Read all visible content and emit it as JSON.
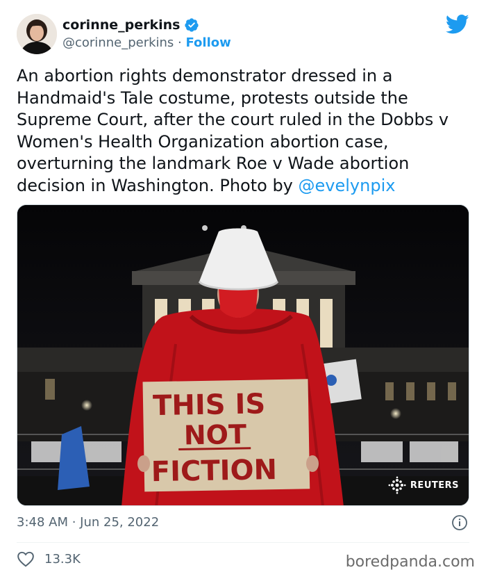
{
  "author": {
    "display_name": "corinne_perkins",
    "handle": "@corinne_perkins",
    "separator": " · ",
    "follow_label": "Follow",
    "verified_icon": "verified-badge-icon",
    "avatar_icon": "avatar"
  },
  "platform_icon": "twitter-bird-icon",
  "tweet": {
    "text": "An abortion rights demonstrator dressed in a Handmaid's Tale costume, protests outside the Supreme Court, after the court ruled in the Dobbs v Women's Health Organization abortion case, overturning the landmark Roe v Wade abortion decision in Washington. Photo by ",
    "mention": "@evelynpix"
  },
  "media": {
    "sign_line1": "THIS IS",
    "sign_line2": "NOT",
    "sign_line3": "FICTION",
    "credit": "REUTERS"
  },
  "meta": {
    "timestamp": "3:48 AM · Jun 25, 2022"
  },
  "engagement": {
    "likes": "13.3K",
    "like_icon": "heart-icon"
  },
  "watermark": "boredpanda.com",
  "colors": {
    "accent": "#1d9bf0",
    "cloak": "#c1121a",
    "sign": "#d8c8aa"
  }
}
